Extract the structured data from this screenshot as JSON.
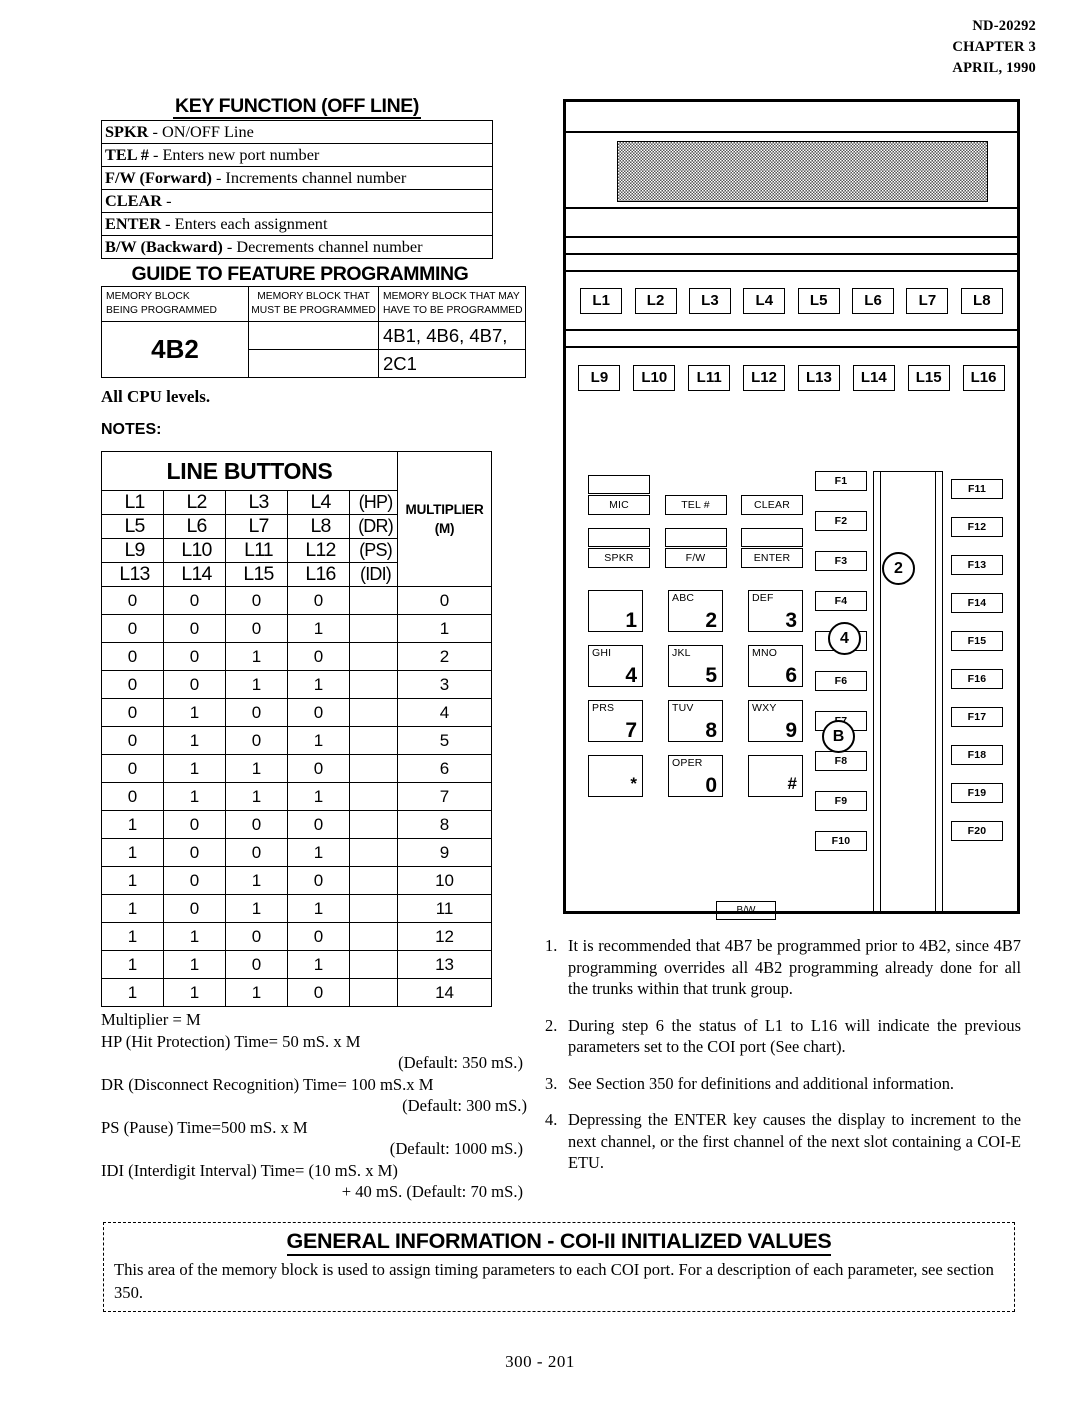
{
  "header": {
    "doc_number": "ND-20292",
    "chapter": "CHAPTER 3",
    "date": "APRIL, 1990"
  },
  "key_function": {
    "title": "KEY FUNCTION (OFF LINE)",
    "rows": [
      {
        "key": "SPKR",
        "desc": "-  ON/OFF Line"
      },
      {
        "key": "TEL #",
        "desc": "-   Enters new port number"
      },
      {
        "key": "F/W (Forward)",
        "desc": "-  Increments channel number"
      },
      {
        "key": "CLEAR",
        "desc": "-"
      },
      {
        "key": "ENTER",
        "desc": "-  Enters each assignment"
      },
      {
        "key": "B/W (Backward)",
        "desc": "- Decrements channel number"
      }
    ]
  },
  "guide": {
    "title": "GUIDE TO FEATURE PROGRAMMING",
    "col1_header": "MEMORY BLOCK\nBEING    PROGRAMMED",
    "col1_line1": "MEMORY BLOCK",
    "col1_line2": "BEING    PROGRAMMED",
    "col2_line1": "MEMORY BLOCK THAT",
    "col2_line2": "MUST BE PROGRAMMED",
    "col3_line1": "MEMORY BLOCK THAT MAY",
    "col3_line2": "HAVE TO BE PROGRAMMED",
    "block_being_programmed": "4B2",
    "must_be_programmed": "",
    "may_have_line1": "4B1, 4B6, 4B7,",
    "may_have_line2": "2C1",
    "cpu_levels": "All CPU levels.",
    "notes_label": "NOTES:"
  },
  "line_buttons": {
    "title": "LINE BUTTONS",
    "multiplier_header_line1": "MULTIPLIER",
    "multiplier_header_line2": "(M)",
    "header_rows": [
      {
        "cells": [
          "L1",
          "L2",
          "L3",
          "L4"
        ],
        "param": "(HP)"
      },
      {
        "cells": [
          "L5",
          "L6",
          "L7",
          "L8"
        ],
        "param": "(DR)"
      },
      {
        "cells": [
          "L9",
          "L10",
          "L11",
          "L12"
        ],
        "param": "(PS)"
      },
      {
        "cells": [
          "L13",
          "L14",
          "L15",
          "L16"
        ],
        "param": "(IDI)"
      }
    ],
    "data_rows": [
      {
        "bits": [
          "0",
          "0",
          "0",
          "0"
        ],
        "m": "0"
      },
      {
        "bits": [
          "0",
          "0",
          "0",
          "1"
        ],
        "m": "1"
      },
      {
        "bits": [
          "0",
          "0",
          "1",
          "0"
        ],
        "m": "2"
      },
      {
        "bits": [
          "0",
          "0",
          "1",
          "1"
        ],
        "m": "3"
      },
      {
        "bits": [
          "0",
          "1",
          "0",
          "0"
        ],
        "m": "4"
      },
      {
        "bits": [
          "0",
          "1",
          "0",
          "1"
        ],
        "m": "5"
      },
      {
        "bits": [
          "0",
          "1",
          "1",
          "0"
        ],
        "m": "6"
      },
      {
        "bits": [
          "0",
          "1",
          "1",
          "1"
        ],
        "m": "7"
      },
      {
        "bits": [
          "1",
          "0",
          "0",
          "0"
        ],
        "m": "8"
      },
      {
        "bits": [
          "1",
          "0",
          "0",
          "1"
        ],
        "m": "9"
      },
      {
        "bits": [
          "1",
          "0",
          "1",
          "0"
        ],
        "m": "10"
      },
      {
        "bits": [
          "1",
          "0",
          "1",
          "1"
        ],
        "m": "11"
      },
      {
        "bits": [
          "1",
          "1",
          "0",
          "0"
        ],
        "m": "12"
      },
      {
        "bits": [
          "1",
          "1",
          "0",
          "1"
        ],
        "m": "13"
      },
      {
        "bits": [
          "1",
          "1",
          "1",
          "0"
        ],
        "m": "14"
      }
    ]
  },
  "multiplier_legend": {
    "l1": "Multiplier = M",
    "l2": "HP (Hit Protection) Time= 50 mS.  x M",
    "l3": "(Default:  350 mS.)",
    "l4": "DR (Disconnect Recognition) Time= 100 mS.x M",
    "l5": "(Default: 300 mS.)",
    "l6": "PS (Pause) Time=500 mS. x M",
    "l7": "(Default:  1000 mS.)",
    "l8": "IDI (Interdigit Interval) Time=  (10 mS. x M)",
    "l9": "+ 40 mS. (Default: 70 mS.)"
  },
  "phone": {
    "line_buttons_row1": [
      "L1",
      "L2",
      "L3",
      "L4",
      "L5",
      "L6",
      "L7",
      "L8"
    ],
    "line_buttons_row2": [
      "L9",
      "L10",
      "L11",
      "L12",
      "L13",
      "L14",
      "L15",
      "L16"
    ],
    "function_keys_left": [
      "F1",
      "F2",
      "F3",
      "F4",
      "F5",
      "F6",
      "F7",
      "F8",
      "F9",
      "F10"
    ],
    "function_keys_right": [
      "F11",
      "F12",
      "F13",
      "F14",
      "F15",
      "F16",
      "F17",
      "F18",
      "F19",
      "F20"
    ],
    "feature_keys": [
      {
        "label": "MIC"
      },
      {
        "label": "TEL #"
      },
      {
        "label": "CLEAR"
      },
      {
        "label": "SPKR"
      },
      {
        "label": "F/W"
      },
      {
        "label": "ENTER"
      }
    ],
    "dial_keys": [
      {
        "letters": "",
        "num": "1"
      },
      {
        "letters": "ABC",
        "num": "2"
      },
      {
        "letters": "DEF",
        "num": "3"
      },
      {
        "letters": "GHI",
        "num": "4"
      },
      {
        "letters": "JKL",
        "num": "5"
      },
      {
        "letters": "MNO",
        "num": "6"
      },
      {
        "letters": "PRS",
        "num": "7"
      },
      {
        "letters": "TUV",
        "num": "8"
      },
      {
        "letters": "WXY",
        "num": "9"
      },
      {
        "letters": "",
        "num": "*"
      },
      {
        "letters": "OPER",
        "num": "0"
      },
      {
        "letters": "",
        "num": "#"
      }
    ],
    "bw_key": "B/W",
    "callouts": [
      "2",
      "4",
      "B"
    ]
  },
  "notes": [
    {
      "n": "1.",
      "text": "It is recommended that 4B7 be programmed prior to 4B2, since 4B7 programming overrides all 4B2 programming already done for all the trunks within that trunk group."
    },
    {
      "n": "2.",
      "text": "During step 6 the status of L1 to L16 will indicate the previous parameters set to the COI port (See chart)."
    },
    {
      "n": "3.",
      "text": "See Section 350 for definitions and additional information."
    },
    {
      "n": "4.",
      "text": "Depressing the ENTER key  causes the display to increment to the next channel, or the first channel of the next slot containing a COI-E ETU."
    }
  ],
  "general_info": {
    "title": "GENERAL INFORMATION - COI-II INITIALIZED VALUES",
    "body": "This area of the memory block is used to assign timing parameters to each COI port.  For a  description of each parameter, see section 350."
  },
  "footer": {
    "page": "300 - 201"
  }
}
